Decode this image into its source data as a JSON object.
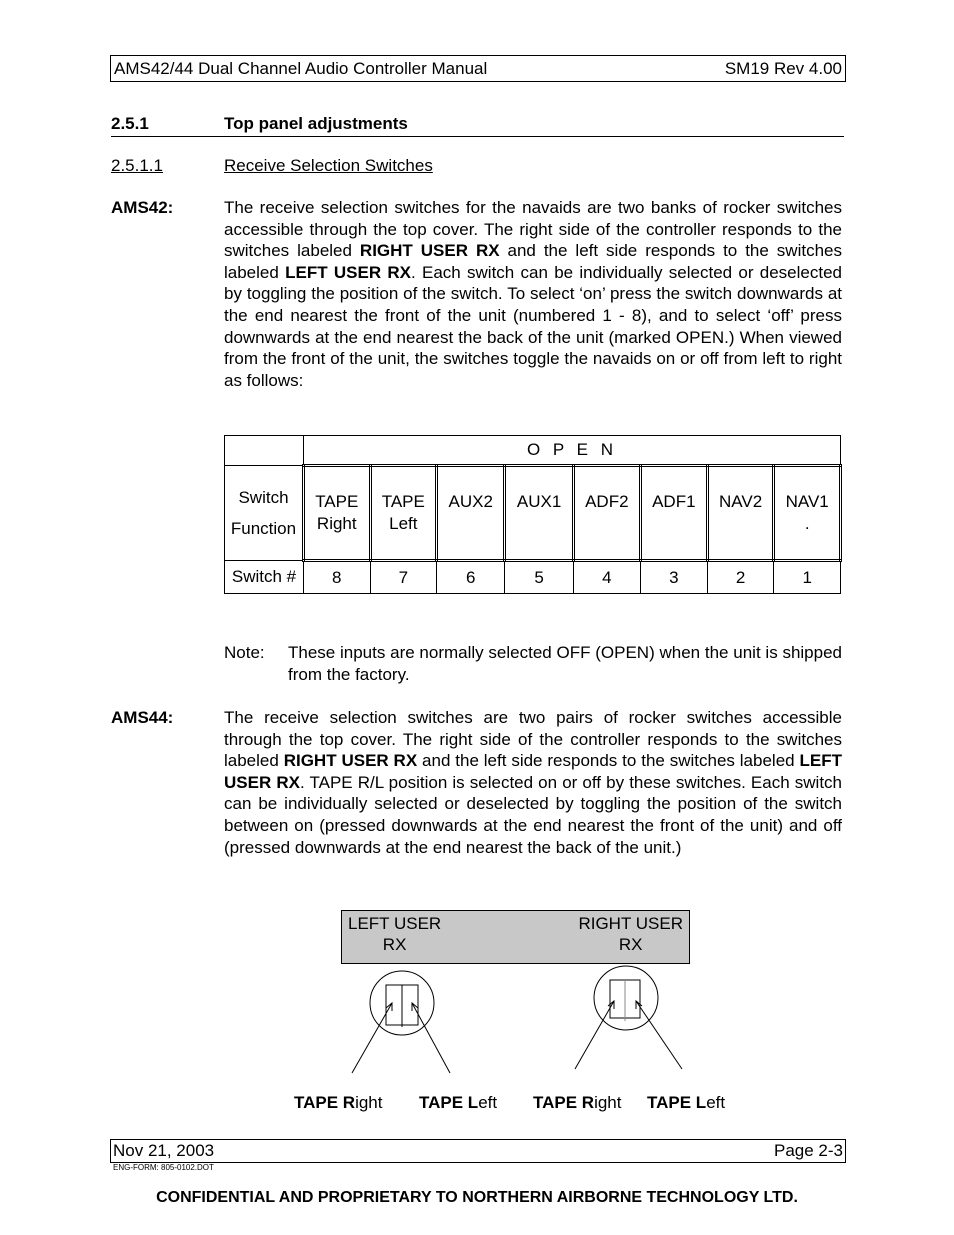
{
  "header": {
    "title": "AMS42/44 Dual Channel Audio Controller Manual",
    "revision": "SM19 Rev 4.00"
  },
  "section": {
    "number": "2.5.1",
    "title": "Top panel adjustments"
  },
  "subsection": {
    "number": "2.5.1.1",
    "title": "Receive Selection Switches"
  },
  "ams42": {
    "label": "AMS42:",
    "text_parts": [
      "The receive selection switches for the navaids are two banks of rocker switches accessible through the top cover. The right side of the controller responds to the switches labeled ",
      "RIGHT USER RX",
      " and the left side responds to the switches labeled ",
      "LEFT USER RX",
      ".  Each switch can be individually selected or deselected by toggling the position of the switch. To select ‘on’ press the switch downwards at the end nearest the front of the unit (numbered 1 - 8), and to select ‘off’ press downwards at the end nearest the back of the unit (marked OPEN.)  When viewed from the front of the unit, the switches toggle the navaids on or off from left to right as follows:"
    ]
  },
  "switch_table": {
    "open_label": "O P E N",
    "function_header_line1": "Switch",
    "function_header_line2": "Function",
    "number_header": "Switch #",
    "columns": [
      {
        "line1": "TAPE",
        "line2": "Right",
        "number": "8"
      },
      {
        "line1": "TAPE",
        "line2": "Left",
        "number": "7"
      },
      {
        "line1": "AUX2",
        "line2": "",
        "number": "6"
      },
      {
        "line1": "AUX1",
        "line2": "",
        "number": "5"
      },
      {
        "line1": "ADF2",
        "line2": "",
        "number": "4"
      },
      {
        "line1": "ADF1",
        "line2": "",
        "number": "3"
      },
      {
        "line1": "NAV2",
        "line2": "",
        "number": "2"
      },
      {
        "line1": "NAV1",
        "line2": ".",
        "number": "1"
      }
    ]
  },
  "note": {
    "label": "Note:",
    "text": "These inputs are normally selected OFF (OPEN) when the unit is shipped from the factory."
  },
  "ams44": {
    "label": "AMS44:",
    "text_parts": [
      "The receive selection switches are two pairs of rocker switches accessible through the top cover. The right side of the controller responds to the switches labeled ",
      "RIGHT USER RX",
      " and the left side responds to the switches labeled ",
      "LEFT USER RX",
      ". TAPE R/L position is selected on or off by these switches.  Each switch can be individually selected or deselected by toggling the position of the switch between on (pressed downwards at the end nearest the front of the unit) and off (pressed downwards at the end nearest the back of the unit.)"
    ]
  },
  "diagram": {
    "left_panel_line1": "LEFT USER",
    "left_panel_line2": "RX",
    "right_panel_line1": "RIGHT USER",
    "right_panel_line2": "RX",
    "panel_color": "#c8c8c8",
    "captions": [
      {
        "bold": "TAPE R",
        "rest": "ight"
      },
      {
        "bold": "TAPE L",
        "rest": "eft"
      },
      {
        "bold": "TAPE R",
        "rest": "ight"
      },
      {
        "bold": "TAPE L",
        "rest": "eft"
      }
    ]
  },
  "footer": {
    "date": "Nov 21, 2003",
    "page": "Page 2-3",
    "form": "ENG-FORM: 805-0102.DOT",
    "confidential": "CONFIDENTIAL AND PROPRIETARY TO NORTHERN AIRBORNE TECHNOLOGY LTD."
  }
}
